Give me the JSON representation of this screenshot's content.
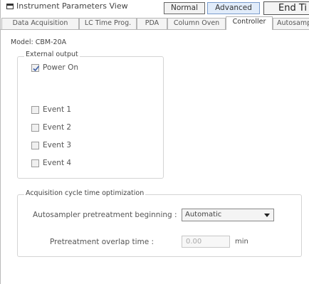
{
  "window": {
    "title": "Instrument Parameters View",
    "mode_buttons": {
      "normal": "Normal",
      "advanced": "Advanced"
    },
    "end_button": "End Ti"
  },
  "tabs": [
    {
      "label": "Data Acquisition"
    },
    {
      "label": "LC Time Prog."
    },
    {
      "label": "PDA"
    },
    {
      "label": "Column Oven"
    },
    {
      "label": "Controller",
      "active": true
    },
    {
      "label": "Autosamp"
    }
  ],
  "controller": {
    "model": "Model: CBM-20A",
    "external_output": {
      "title": "External output",
      "items": [
        {
          "label": "Power On",
          "checked": true
        },
        {
          "label": "Event 1",
          "checked": false
        },
        {
          "label": "Event 2",
          "checked": false
        },
        {
          "label": "Event 3",
          "checked": false
        },
        {
          "label": "Event 4",
          "checked": false
        }
      ]
    },
    "acquisition": {
      "title": "Acquisition cycle time optimization",
      "pretreatment_label": "Autosampler pretreatment beginning :",
      "pretreatment_value": "Automatic",
      "overlap_label": "Pretreatment overlap time :",
      "overlap_value": "0.00",
      "overlap_unit": "min"
    }
  }
}
